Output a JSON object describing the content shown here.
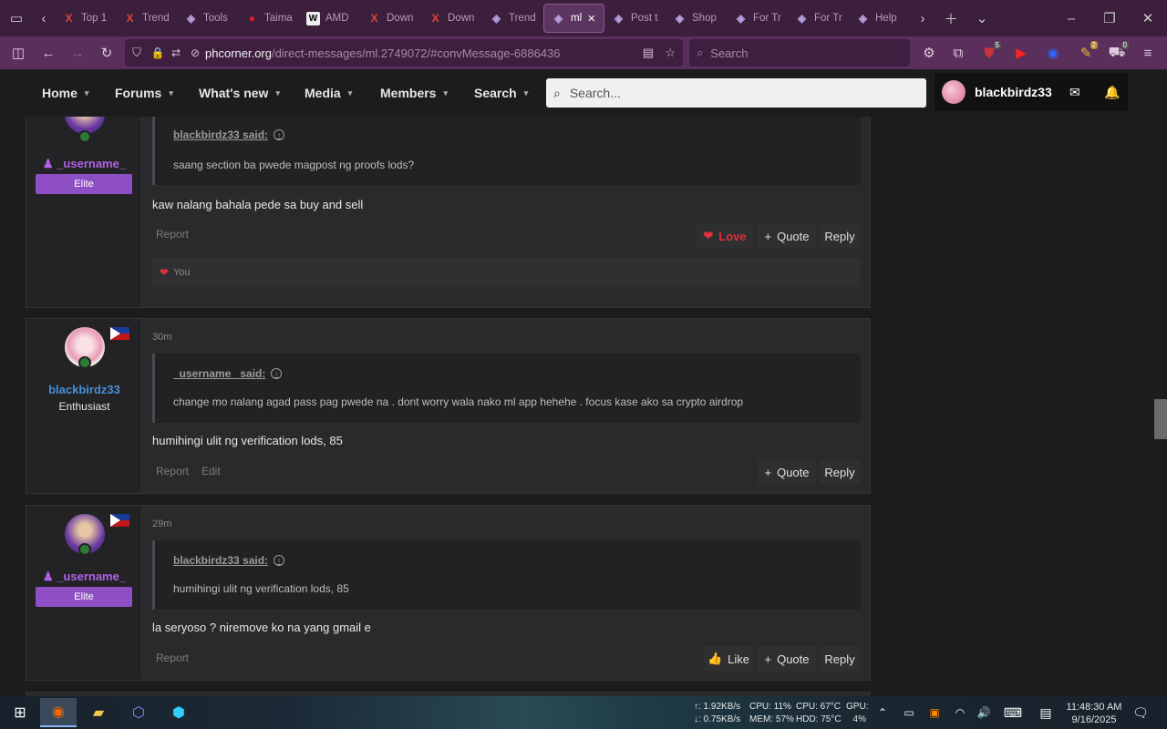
{
  "browser": {
    "tabs": [
      {
        "label": "Top 1",
        "icon": "x-icon",
        "color": "#e0453a"
      },
      {
        "label": "Trend",
        "icon": "x-icon",
        "color": "#e0453a"
      },
      {
        "label": "Tools",
        "icon": "cube-icon",
        "color": "#b8a0e0"
      },
      {
        "label": "Taima",
        "icon": "drop-icon",
        "color": "#d22"
      },
      {
        "label": "AMD",
        "icon": "w-icon",
        "color": "#fff"
      },
      {
        "label": "Down",
        "icon": "x-icon",
        "color": "#e0453a"
      },
      {
        "label": "Down",
        "icon": "x-icon",
        "color": "#e0453a"
      },
      {
        "label": "Trend",
        "icon": "cube-icon",
        "color": "#b8a0e0"
      },
      {
        "label": "ml",
        "icon": "cube-icon",
        "color": "#b8a0e0",
        "active": true
      },
      {
        "label": "Post t",
        "icon": "cube-icon",
        "color": "#b8a0e0"
      },
      {
        "label": "Shop",
        "icon": "cube-icon",
        "color": "#b8a0e0"
      },
      {
        "label": "For Tr",
        "icon": "cube-icon",
        "color": "#b8a0e0"
      },
      {
        "label": "For Tr",
        "icon": "cube-icon",
        "color": "#b8a0e0"
      },
      {
        "label": "Help",
        "icon": "cube-icon",
        "color": "#b8a0e0"
      }
    ],
    "url_domain": "phcorner.org",
    "url_path": "/direct-messages/ml.2749072/#convMessage-6886436",
    "search_placeholder": "Search",
    "badge_counts": {
      "ublock": "5",
      "ext2": "2",
      "ext3": "0"
    }
  },
  "site_nav": {
    "items": [
      "Home",
      "Forums",
      "What's new",
      "Media",
      "Members",
      "Search"
    ],
    "search_placeholder": "Search...",
    "username": "blackbirdz33"
  },
  "messages": [
    {
      "username": "_username_",
      "rank": "Elite",
      "quote_author": "blackbirdz33 said:",
      "quote_text": "saang section ba pwede magpost ng proofs lods?",
      "body": "kaw nalang bahala pede sa buy and sell",
      "actions": [
        "Report"
      ],
      "love_label": "Love",
      "quote_label": "Quote",
      "reply_label": "Reply",
      "reaction_text": "You"
    },
    {
      "time": "30m",
      "username": "blackbirdz33",
      "rank": "Enthusiast",
      "quote_author": "_username_ said:",
      "quote_text": "change mo nalang agad pass pag pwede na . dont worry wala nako ml app hehehe . focus kase ako sa crypto airdrop",
      "body": "humihingi ulit ng verification lods, 85",
      "actions": [
        "Report",
        "Edit"
      ],
      "quote_label": "Quote",
      "reply_label": "Reply"
    },
    {
      "time": "29m",
      "username": "_username_",
      "rank": "Elite",
      "quote_author": "blackbirdz33 said:",
      "quote_text": "humihingi ulit ng verification lods, 85",
      "body": "la seryoso ? niremove ko na yang gmail e",
      "actions": [
        "Report"
      ],
      "like_label": "Like",
      "quote_label": "Quote",
      "reply_label": "Reply"
    }
  ],
  "taskbar": {
    "net_up": "↑: 1.92KB/s",
    "net_down": "↓: 0.75KB/s",
    "cpu": "CPU: 11%",
    "cpu_temp": "CPU: 67°C",
    "gpu": "GPU:",
    "mem": "MEM: 57%",
    "hdd": "HDD: 75°C",
    "gpu_val": "4%",
    "time": "11:48:30 AM",
    "date": "9/16/2025"
  },
  "colors": {
    "elite": "#8f4fc4",
    "accent_purple": "#5a2f5c",
    "link_blue": "#4a8fd8",
    "love": "#e0303a"
  }
}
